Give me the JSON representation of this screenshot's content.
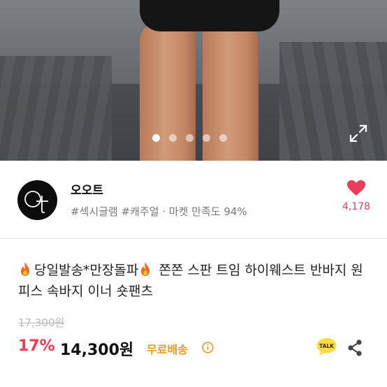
{
  "gallery": {
    "dot_count": 5,
    "active_index": 0
  },
  "store": {
    "logo_text": "OT",
    "name": "오오트",
    "tags": "#섹시글램 #캐주얼 · 마켓 만족도 94%",
    "likes": "4,178"
  },
  "product": {
    "title_part1": "당일발송*만장돌파",
    "title_part2": " 쫀쫀 스판 트임 하이웨스트 반바지 원피스 속바지 이너 숏팬츠",
    "original_price": "17,300원",
    "discount": "17%",
    "price": "14,300원",
    "shipping": "무료배송"
  },
  "actions": {
    "talk_label": "TALK"
  },
  "colors": {
    "discount": "#f0394f",
    "shipping": "#f09a1a",
    "heart": "#e83e5b",
    "talk_bubble": "#fddc3f"
  }
}
